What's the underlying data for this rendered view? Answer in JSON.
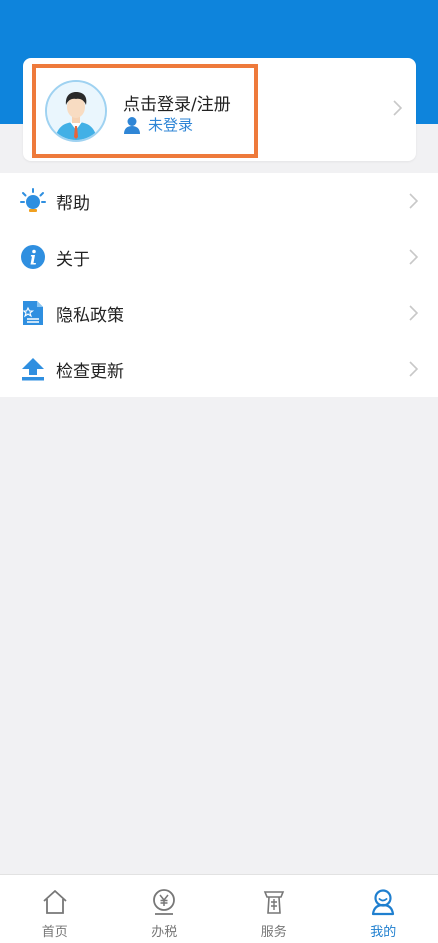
{
  "colors": {
    "header_blue": "#0e84dc",
    "highlight_orange": "#ee7a3b",
    "accent_blue": "#2f86d6",
    "nav_active": "#1f7fcf",
    "background": "#f1f1f3"
  },
  "profile": {
    "login_title": "点击登录/注册",
    "status_text": "未登录",
    "avatar_icon": "avatar-icon",
    "status_icon": "user-icon",
    "chevron_icon": "chevron-right-icon"
  },
  "menu": {
    "items": [
      {
        "label": "帮助",
        "icon": "lightbulb-icon"
      },
      {
        "label": "关于",
        "icon": "info-icon"
      },
      {
        "label": "隐私政策",
        "icon": "document-icon"
      },
      {
        "label": "检查更新",
        "icon": "upload-icon"
      }
    ]
  },
  "bottom_nav": {
    "items": [
      {
        "label": "首页",
        "icon": "home-icon",
        "active": false
      },
      {
        "label": "办税",
        "icon": "yuan-icon",
        "active": false
      },
      {
        "label": "服务",
        "icon": "service-icon",
        "active": false
      },
      {
        "label": "我的",
        "icon": "profile-icon",
        "active": true
      }
    ]
  }
}
